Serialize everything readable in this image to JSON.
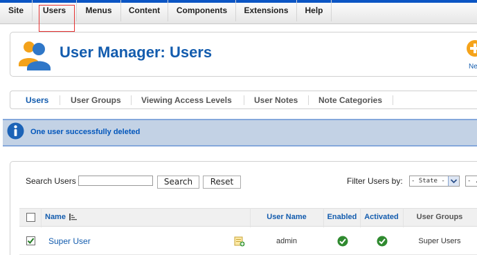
{
  "menu": {
    "items": [
      "Site",
      "Users",
      "Menus",
      "Content",
      "Components",
      "Extensions",
      "Help"
    ]
  },
  "toolbar": {
    "title": "User Manager: Users",
    "new_label": "Ne"
  },
  "submenu": {
    "items": [
      "Users",
      "User Groups",
      "Viewing Access Levels",
      "User Notes",
      "Note Categories"
    ]
  },
  "message": {
    "text": "One user successfully deleted"
  },
  "filters": {
    "search_label": "Search Users",
    "search_value": "",
    "search_button": "Search",
    "reset_button": "Reset",
    "filter_label": "Filter Users by:",
    "state_select": "- State -",
    "second_select": "- ."
  },
  "table": {
    "headers": {
      "name": "Name",
      "username": "User Name",
      "enabled": "Enabled",
      "activated": "Activated",
      "groups": "User Groups"
    },
    "rows": [
      {
        "name": "Super User",
        "username": "admin",
        "groups": "Super Users",
        "checked": true,
        "enabled": true,
        "activated": true
      }
    ]
  },
  "colors": {
    "menu_accent": "#0b55c4",
    "title_blue": "#135cae",
    "message_bg": "#c3d2e5",
    "status_green": "#2f8a2f",
    "highlight_box": "#e53030"
  }
}
